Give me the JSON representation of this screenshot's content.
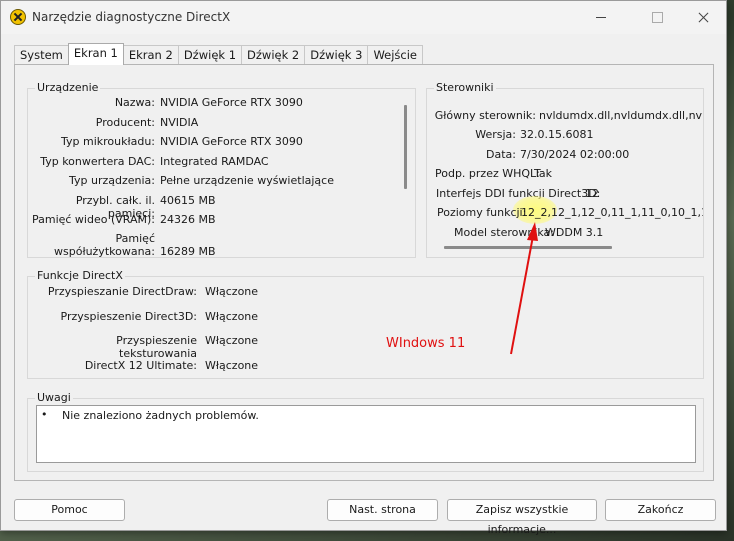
{
  "window": {
    "title": "Narzędzie diagnostyczne DirectX"
  },
  "tabs": [
    "System",
    "Ekran 1",
    "Ekran 2",
    "Dźwięk 1",
    "Dźwięk 2",
    "Dźwięk 3",
    "Wejście"
  ],
  "device": {
    "label": "Urządzenie",
    "rows": [
      {
        "label": "Nazwa:",
        "value": "NVIDIA GeForce RTX 3090"
      },
      {
        "label": "Producent:",
        "value": "NVIDIA"
      },
      {
        "label": "Typ mikroukładu:",
        "value": "NVIDIA GeForce RTX 3090"
      },
      {
        "label": "Typ konwertera DAC:",
        "value": "Integrated RAMDAC"
      },
      {
        "label": "Typ urządzenia:",
        "value": "Pełne urządzenie wyświetlające"
      },
      {
        "label": "Przybl. całk. il. pamięci:",
        "value": "40615 MB"
      },
      {
        "label": "Pamięć wideo (VRAM):",
        "value": "24326 MB"
      },
      {
        "label": "Pamięć",
        "label2": "współużytkowana:",
        "value": "16289 MB"
      }
    ]
  },
  "drivers": {
    "label": "Sterowniki",
    "rows": [
      {
        "label": "Główny sterownik:",
        "value": "nvldumdx.dll,nvldumdx.dll,nvldumd"
      },
      {
        "label": "Wersja:",
        "value": "32.0.15.6081"
      },
      {
        "label": "Data:",
        "value": "7/30/2024 02:00:00"
      },
      {
        "label": "Podp. przez WHQL:",
        "value": "Tak"
      },
      {
        "label": "Interfejs DDI funkcji Direct3D:",
        "value": "12"
      },
      {
        "label": "Poziomy funkcji:",
        "value": "12_2,12_1,12_0,11_1,11_0,10_1,10_"
      },
      {
        "label": "Model sterownika:",
        "value": "WDDM 3.1"
      }
    ]
  },
  "features": {
    "label": "Funkcje DirectX",
    "rows": [
      {
        "label": "Przyspieszanie DirectDraw:",
        "value": "Włączone"
      },
      {
        "label": "Przyspieszenie Direct3D:",
        "value": "Włączone"
      },
      {
        "label": "Przyspieszenie teksturowania",
        "value": "Włączone"
      },
      {
        "label": "DirectX 12 Ultimate:",
        "value": "Włączone"
      }
    ]
  },
  "notes": {
    "label": "Uwagi",
    "bullet": "•",
    "text": "Nie znaleziono żadnych problemów."
  },
  "buttons": {
    "help": "Pomoc",
    "next": "Nast. strona",
    "save": "Zapisz wszystkie informacje...",
    "exit": "Zakończ"
  },
  "annotation": {
    "text": "WIndows 11",
    "color": "#e01010"
  }
}
